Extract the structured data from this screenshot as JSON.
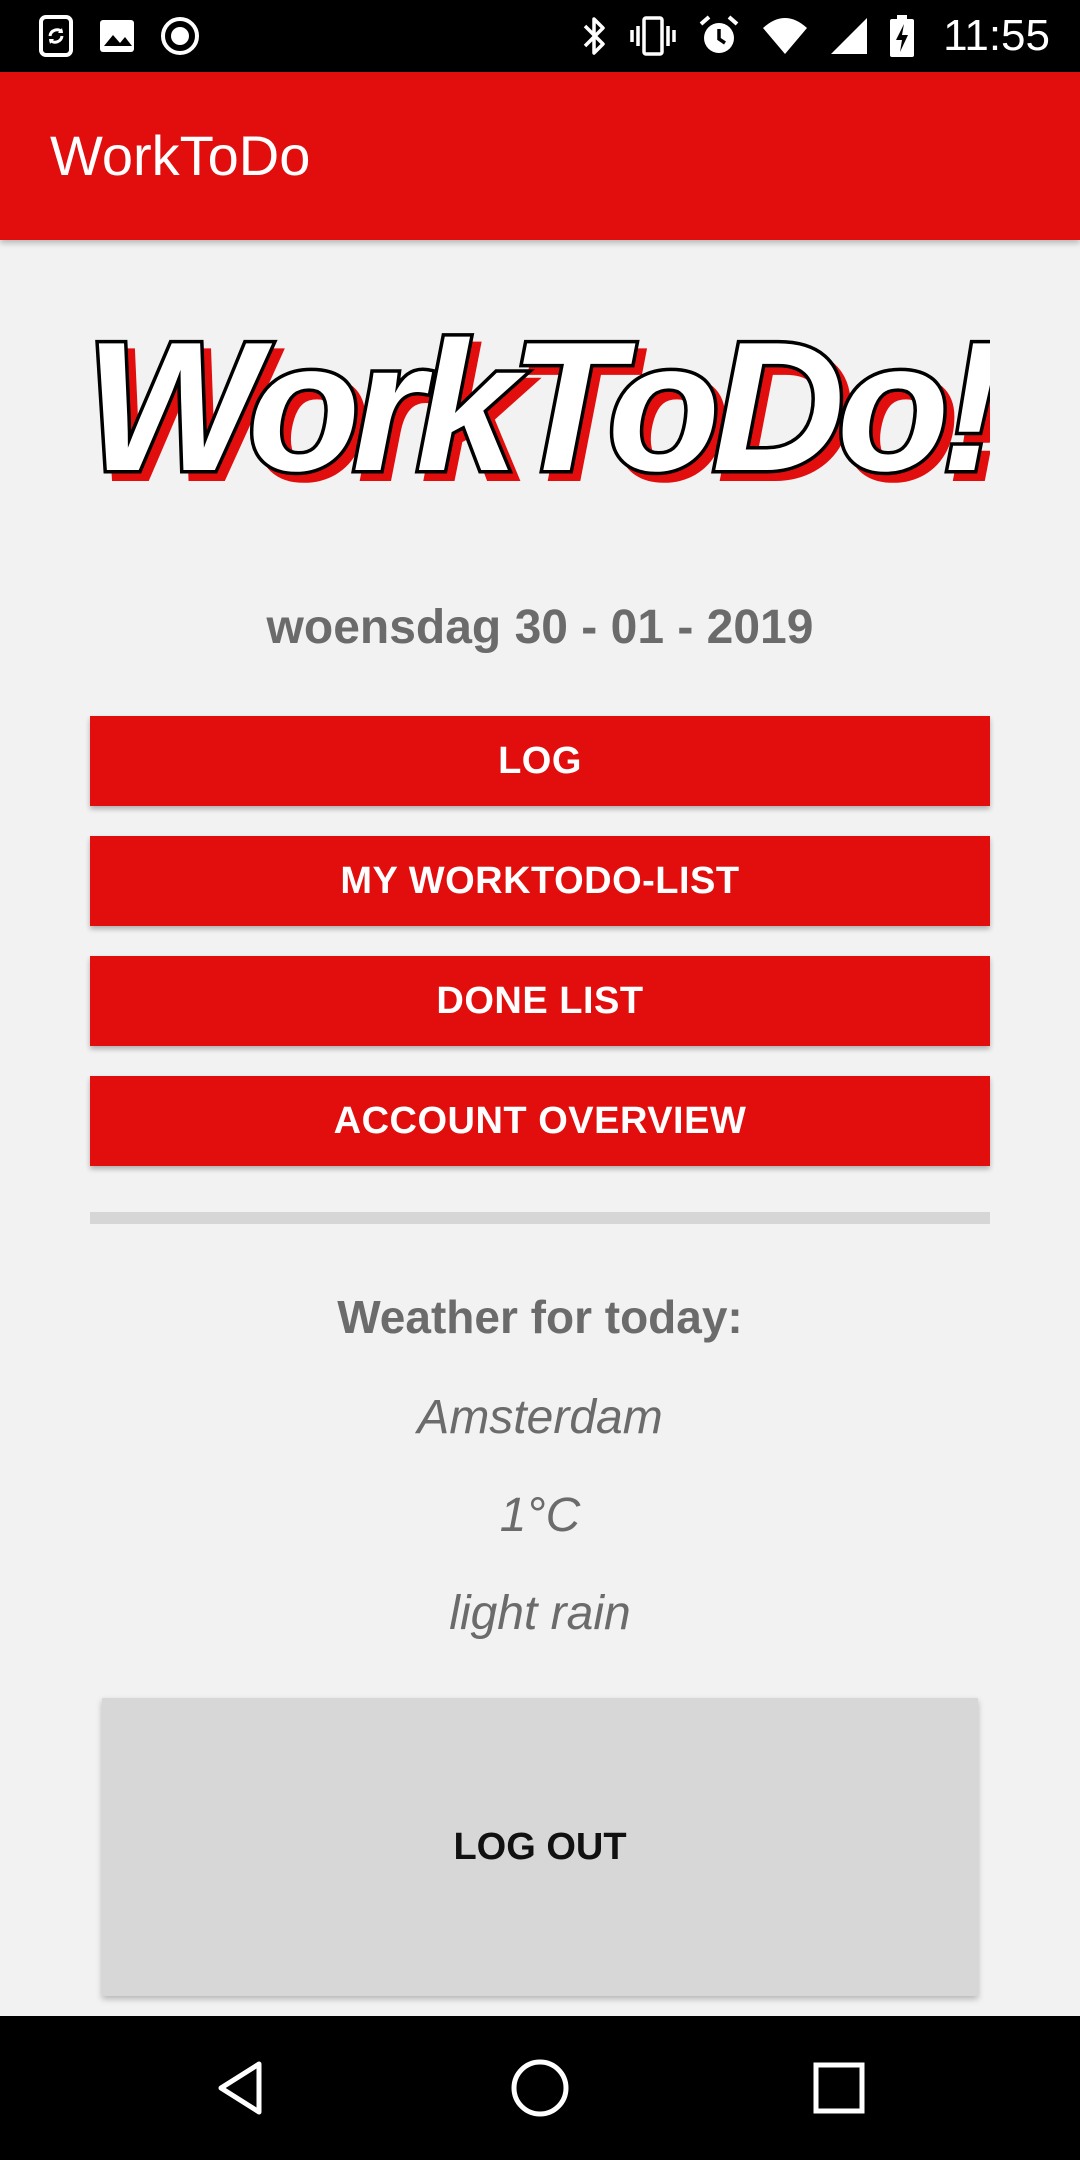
{
  "status_bar": {
    "time": "11:55",
    "left_icons": [
      "screen-rotation-icon",
      "image-icon",
      "record-icon"
    ],
    "right_icons": [
      "bluetooth-icon",
      "vibrate-icon",
      "alarm-icon",
      "wifi-icon",
      "signal-icon",
      "battery-charging-icon"
    ]
  },
  "app_bar": {
    "title": "WorkToDo"
  },
  "logo": {
    "text": "WorkToDo!"
  },
  "date": "woensdag 30 - 01 - 2019",
  "menu": {
    "log": "LOG",
    "worktodo_list": "MY WORKTODO-LIST",
    "done_list": "DONE LIST",
    "account_overview": "ACCOUNT OVERVIEW"
  },
  "weather": {
    "title": "Weather for today:",
    "city": "Amsterdam",
    "temperature": "1°C",
    "description": "light rain"
  },
  "logout": "LOG OUT",
  "nav": {
    "icons": [
      "back-icon",
      "home-icon",
      "recents-icon"
    ]
  },
  "colors": {
    "accent": "#e20e0e",
    "background": "#f2f2f2",
    "text_gray": "#6b6b6b",
    "button_gray": "#d6d7d6"
  }
}
